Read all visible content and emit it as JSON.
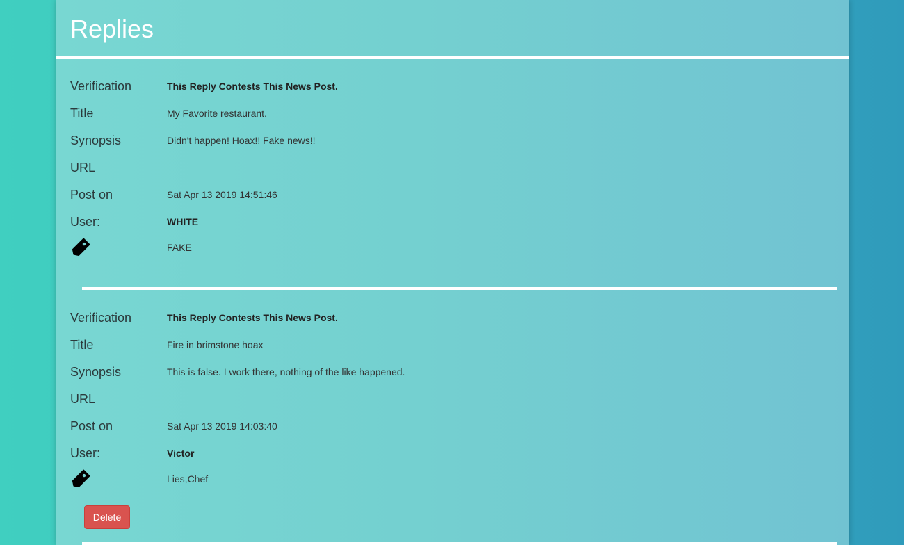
{
  "page": {
    "title": "Replies"
  },
  "labels": {
    "verification": "Verification",
    "title": "Title",
    "synopsis": "Synopsis",
    "url": "URL",
    "post_on": "Post on",
    "user": "User:"
  },
  "replies": [
    {
      "verification": "This Reply Contests This News Post.",
      "title": "My Favorite restaurant.",
      "synopsis": "Didn't happen! Hoax!! Fake news!!",
      "url": "",
      "post_on": "Sat Apr 13 2019 14:51:46",
      "user": "WHITE",
      "tags": "FAKE"
    },
    {
      "verification": "This Reply Contests This News Post.",
      "title": "Fire in brimstone hoax",
      "synopsis": "This is false. I work there, nothing of the like happened.",
      "url": "",
      "post_on": "Sat Apr 13 2019 14:03:40",
      "user": "Victor",
      "tags": "Lies,Chef",
      "delete_label": "Delete"
    }
  ],
  "icons": {
    "tag": "tag-icon"
  },
  "colors": {
    "delete": "#d9534f",
    "divider": "#ffffff"
  }
}
